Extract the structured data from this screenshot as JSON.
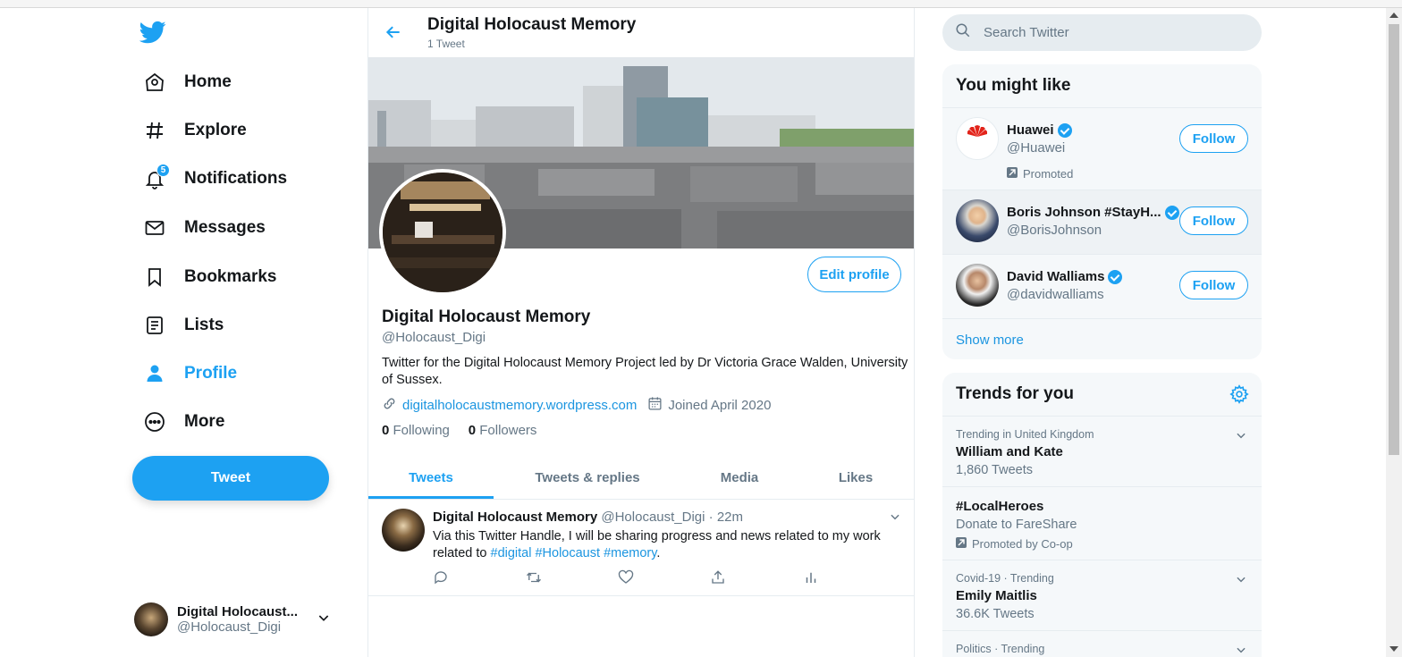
{
  "nav": {
    "items": [
      {
        "label": "Home",
        "icon": "home-icon"
      },
      {
        "label": "Explore",
        "icon": "hashtag-icon"
      },
      {
        "label": "Notifications",
        "icon": "bell-icon",
        "badge": "5"
      },
      {
        "label": "Messages",
        "icon": "envelope-icon"
      },
      {
        "label": "Bookmarks",
        "icon": "bookmark-icon"
      },
      {
        "label": "Lists",
        "icon": "list-icon"
      },
      {
        "label": "Profile",
        "icon": "person-icon"
      },
      {
        "label": "More",
        "icon": "more-icon"
      }
    ],
    "tweet_button": "Tweet",
    "account": {
      "name": "Digital Holocaust...",
      "handle": "@Holocaust_Digi"
    }
  },
  "header": {
    "title": "Digital Holocaust Memory",
    "tweet_count": "1 Tweet"
  },
  "profile": {
    "edit_button": "Edit profile",
    "name": "Digital Holocaust Memory",
    "handle": "@Holocaust_Digi",
    "bio": "Twitter for the Digital Holocaust Memory Project led by Dr Victoria Grace Walden, University of Sussex.",
    "website": "digitalholocaustmemory.wordpress.com",
    "joined": "Joined April 2020",
    "following_count": "0",
    "following_label": "Following",
    "followers_count": "0",
    "followers_label": "Followers"
  },
  "tabs": [
    "Tweets",
    "Tweets & replies",
    "Media",
    "Likes"
  ],
  "tweet": {
    "name": "Digital Holocaust Memory",
    "handle_time": "@Holocaust_Digi · 22m",
    "text_before": "Via this Twitter Handle, I will be sharing progress and news related to my work related to ",
    "tags": [
      "#digital",
      "#Holocaust",
      "#memory"
    ],
    "text_after": "."
  },
  "search": {
    "placeholder": "Search Twitter"
  },
  "you_might_like": {
    "title": "You might like",
    "accounts": [
      {
        "name": "Huawei",
        "handle": "@Huawei",
        "promoted": "Promoted",
        "follow": "Follow"
      },
      {
        "name": "Boris Johnson #StayH...",
        "handle": "@BorisJohnson",
        "follow": "Follow"
      },
      {
        "name": "David Walliams",
        "handle": "@davidwalliams",
        "follow": "Follow"
      }
    ],
    "show_more": "Show more"
  },
  "trends": {
    "title": "Trends for you",
    "items": [
      {
        "context": "Trending in United Kingdom",
        "title": "William and Kate",
        "sub": "1,860 Tweets"
      },
      {
        "context": "",
        "title": "#LocalHeroes",
        "sub": "Donate to FareShare",
        "promoted": "Promoted by Co-op"
      },
      {
        "context": "Covid-19 · Trending",
        "title": "Emily Maitlis",
        "sub": "36.6K Tweets"
      },
      {
        "context": "Politics · Trending",
        "title": "",
        "sub": ""
      }
    ]
  },
  "colors": {
    "accent": "#1da1f2",
    "text": "#14171a",
    "muted": "#657786",
    "panel": "#f5f8fa"
  }
}
